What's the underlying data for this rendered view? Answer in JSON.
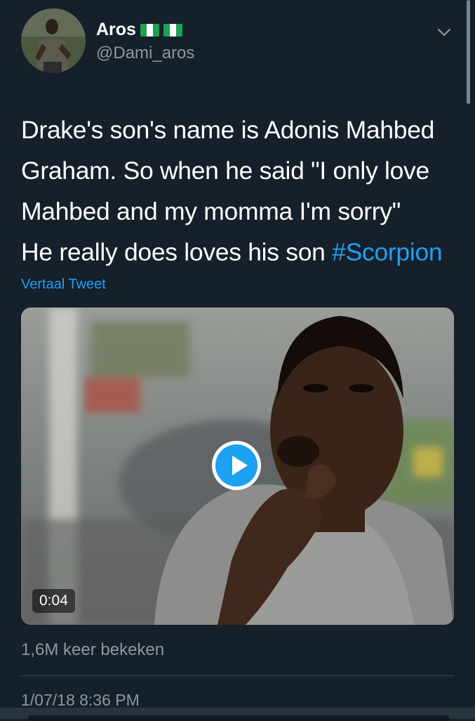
{
  "author": {
    "name": "Aros",
    "handle": "@Dami_aros",
    "flags": [
      "nigeria-flag",
      "nigeria-flag"
    ]
  },
  "tweet": {
    "lines": [
      "Drake's son's name is Adonis Mahbed",
      "Graham. So when he said \"I only love",
      "Mahbed and my momma I'm sorry\"",
      "He really does loves his son "
    ],
    "hashtag": "#Scorpion",
    "translate_label": "Vertaal Tweet"
  },
  "media": {
    "type": "video",
    "duration": "0:04",
    "play_icon": "play-icon"
  },
  "stats": {
    "views": "1,6M keer bekeken"
  },
  "meta": {
    "timestamp": "1/07/18 8:36 PM"
  },
  "colors": {
    "background": "#15202b",
    "accent": "#1da1f2",
    "secondary_text": "#8899a6",
    "divider": "#38444d"
  }
}
